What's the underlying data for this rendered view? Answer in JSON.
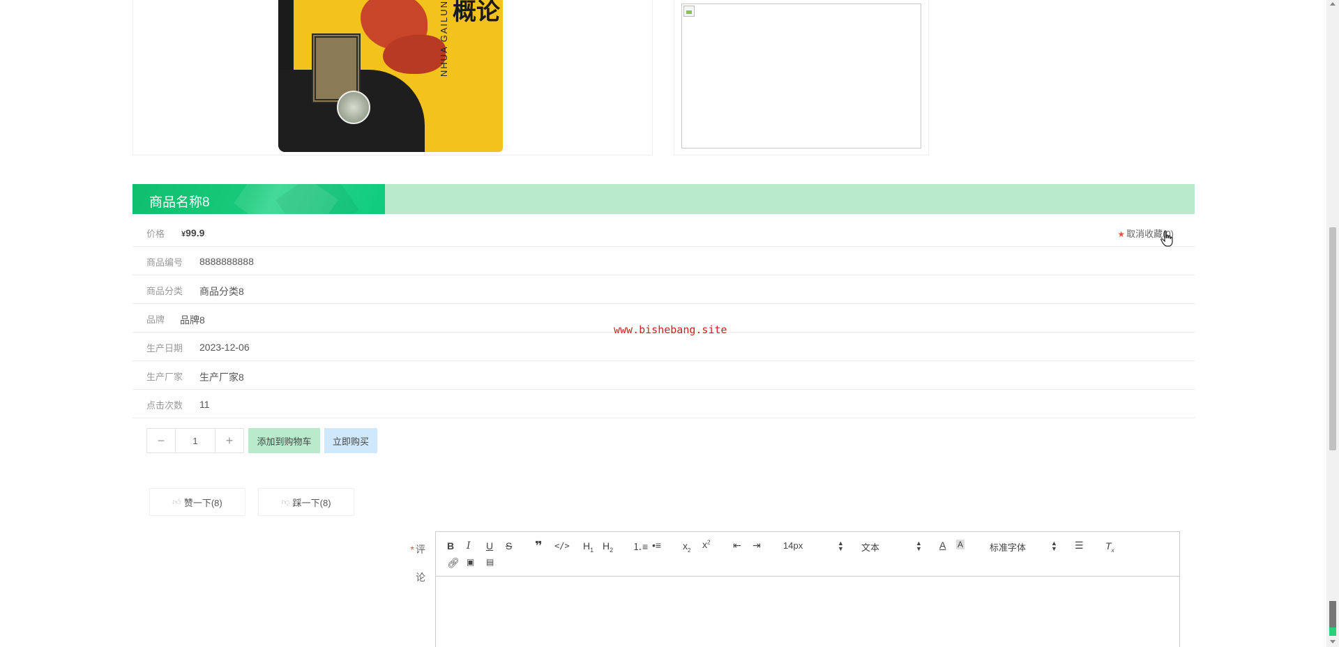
{
  "gallery": {
    "main_image_title": "概论",
    "main_image_subtitle": "NHUA GAILUN"
  },
  "product": {
    "title": "商品名称8",
    "price_label": "价格",
    "price_currency": "¥",
    "price_value": "99.9",
    "favorite_label": "取消收藏(0)",
    "rows": [
      {
        "label": "商品编号",
        "value": "8888888888"
      },
      {
        "label": "商品分类",
        "value": "商品分类8"
      },
      {
        "label": "品牌",
        "value": "品牌8"
      },
      {
        "label": "生产日期",
        "value": "2023-12-06"
      },
      {
        "label": "生产厂家",
        "value": "生产厂家8"
      },
      {
        "label": "点击次数",
        "value": "11"
      }
    ]
  },
  "watermark": "www.bishebang.site",
  "purchase": {
    "minus_icon": "−",
    "plus_icon": "+",
    "quantity": "1",
    "add_to_cart_label": "添加到购物车",
    "buy_now_label": "立即购买"
  },
  "votes": {
    "like_label": "赞一下(8)",
    "dislike_label": "踩一下(8)"
  },
  "comment": {
    "required_mark": "*",
    "label_top": "评",
    "label_bottom": "论",
    "font_size_value": "14px",
    "header_value": "文本",
    "font_family_value": "标准字体"
  },
  "colors": {
    "accent_green": "#0fbf6e",
    "light_green": "#b8ebcb",
    "light_blue": "#cfe8fb",
    "star_red": "#e8533b",
    "watermark_red": "#d21f1f"
  }
}
